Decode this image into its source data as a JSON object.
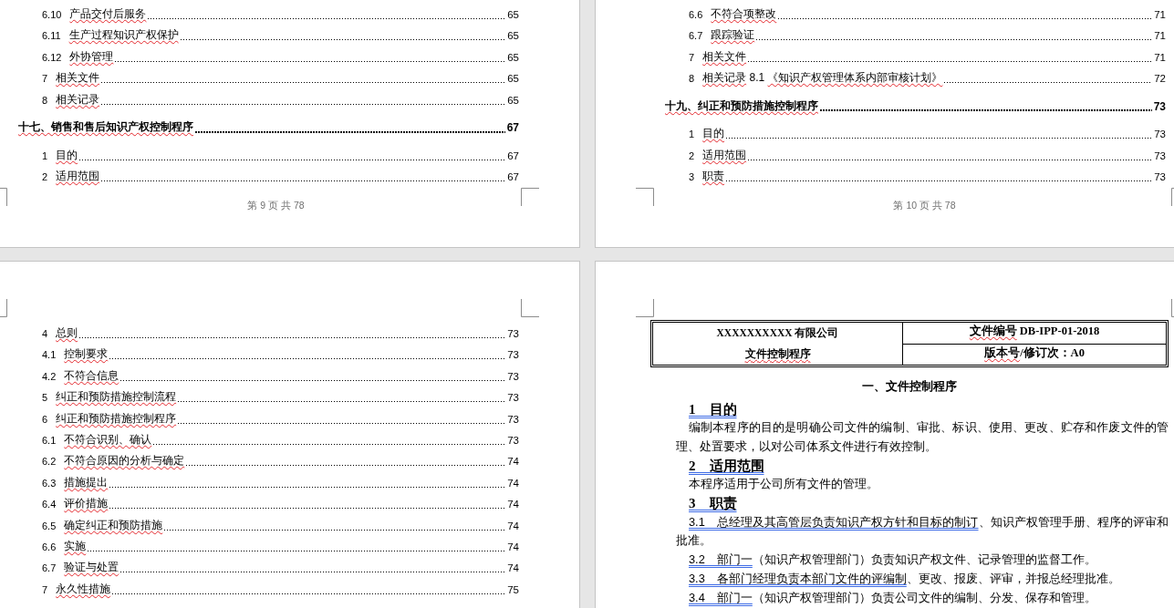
{
  "pages": [
    {
      "kind": "toc",
      "entries": [
        {
          "children": [
            {
              "children": [
                {
                  "number": "6.10",
                  "title": "产品交付后服务",
                  "page": "65",
                  "spelling_error": true
                },
                {
                  "number": "6.11",
                  "title": "生产过程知识产权保护",
                  "page": "65",
                  "spelling_error": true
                },
                {
                  "number": "6.12",
                  "title": "外协管理",
                  "page": "65",
                  "spelling_error": true
                }
              ]
            },
            {
              "number": "7",
              "title": "相关文件",
              "page": "65",
              "spelling_error": true
            },
            {
              "number": "8",
              "title": "相关记录",
              "page": "65",
              "spelling_error": true
            }
          ]
        },
        {
          "title": "十七、销售和售后知识产权控制程序",
          "page": "67",
          "spelling_error": true,
          "children": [
            {
              "number": "1",
              "title": "目的",
              "page": "67",
              "spelling_error": true
            },
            {
              "number": "2",
              "title": "适用范围",
              "page": "67",
              "spelling_error": true
            }
          ]
        }
      ],
      "footer": "第 9 页 共 78"
    },
    {
      "kind": "toc",
      "entries": [
        {
          "children": [
            {
              "children": [
                {
                  "number": "6.6",
                  "title": "不符合项整改",
                  "page": "71",
                  "spelling_error": true
                },
                {
                  "number": "6.7",
                  "title": "跟踪验证",
                  "page": "71",
                  "spelling_error": true
                }
              ]
            },
            {
              "number": "7",
              "title": "相关文件",
              "page": "71",
              "spelling_error": true
            },
            {
              "number": "8",
              "title": [
                {
                  "text": "相关记录",
                  "spelling_error": true
                },
                {
                  "text": " 8.1 "
                },
                {
                  "text": "《知识产权管理体系内部审核计划》",
                  "spelling_error": true
                }
              ],
              "page": "72"
            }
          ]
        },
        {
          "title": "十九、纠正和预防措施控制程序",
          "page": "73",
          "spelling_error": true,
          "children": [
            {
              "number": "1",
              "title": "目的",
              "page": "73",
              "spelling_error": true
            },
            {
              "number": "2",
              "title": "适用范围",
              "page": "73",
              "spelling_error": true
            },
            {
              "number": "3",
              "title": "职责",
              "page": "73",
              "spelling_error": true
            }
          ]
        }
      ],
      "footer": "第 10 页 共 78"
    },
    {
      "kind": "toc",
      "entries": [
        {
          "children": [
            {
              "number": "4",
              "title": "总则",
              "page": "73",
              "spelling_error": true,
              "children": [
                {
                  "number": "4.1",
                  "title": "控制要求",
                  "page": "73",
                  "spelling_error": true
                },
                {
                  "number": "4.2",
                  "title": "不符合信息",
                  "page": "73",
                  "spelling_error": true
                }
              ]
            },
            {
              "number": "5",
              "title": "纠正和预防措施控制流程",
              "page": "73",
              "spelling_error": true
            },
            {
              "number": "6",
              "title": "纠正和预防措施控制程序",
              "page": "73",
              "spelling_error": true,
              "children": [
                {
                  "number": "6.1",
                  "title": "不符合识别、确认",
                  "page": "73",
                  "spelling_error": true
                },
                {
                  "number": "6.2",
                  "title": "不符合原因的分析与确定",
                  "page": "74",
                  "spelling_error": true
                },
                {
                  "number": "6.3",
                  "title": "措施提出",
                  "page": "74",
                  "spelling_error": true
                },
                {
                  "number": "6.4",
                  "title": "评价措施",
                  "page": "74",
                  "spelling_error": true
                },
                {
                  "number": "6.5",
                  "title": "确定纠正和预防措施",
                  "page": "74",
                  "spelling_error": true
                },
                {
                  "number": "6.6",
                  "title": "实施",
                  "page": "74",
                  "spelling_error": true
                },
                {
                  "number": "6.7",
                  "title": "验证与处置",
                  "page": "74",
                  "spelling_error": true
                }
              ]
            },
            {
              "number": "7",
              "title": "永久性措施",
              "page": "75",
              "spelling_error": true
            }
          ]
        }
      ]
    },
    {
      "kind": "document",
      "header_table": {
        "company": "XXXXXXXXXX 有限公司",
        "procedure": [
          {
            "text": "文件控制程序",
            "spelling_error": true
          }
        ],
        "document_number": [
          {
            "text": "文件编号",
            "spelling_error": true
          },
          {
            "text": " DB-IPP-01-2018"
          }
        ],
        "revision": [
          {
            "text": "版本号",
            "spelling_error": true
          },
          {
            "text": "/修订次：A0"
          }
        ]
      },
      "title": "一、文件控制程序",
      "blocks": [
        {
          "kind": "heading",
          "text": "1　目的",
          "grammar_error": true
        },
        {
          "kind": "paragraph",
          "text": "编制本程序的目的是明确公司文件的编制、审批、标识、使用、更改、贮存和作废文件的管理、处置要求，以对公司体系文件进行有效控制。"
        },
        {
          "kind": "heading",
          "text": "2　适用范围",
          "grammar_error": true
        },
        {
          "kind": "paragraph",
          "text": "本程序适用于公司所有文件的管理。"
        },
        {
          "kind": "heading",
          "text": "3　职责",
          "grammar_error": true
        },
        {
          "kind": "paragraph",
          "text": [
            {
              "text": "3.1　总经理及其高管层负责知识产权方针和目标的制订",
              "grammar_error": true
            },
            {
              "text": "、知识产权管理手册、程序的评审和批准。"
            }
          ]
        },
        {
          "kind": "paragraph",
          "text": [
            {
              "text": "3.2　部门一",
              "grammar_error": true
            },
            {
              "text": "（知识产权管理部门）负责知识产权文件、记录管理的监督工作。"
            }
          ]
        },
        {
          "kind": "paragraph",
          "text": [
            {
              "text": "3.3　各部门经理负责本部门文件的评编制",
              "grammar_error": true
            },
            {
              "text": "、更改、报废、评审，并报总经理批准。"
            }
          ]
        },
        {
          "kind": "paragraph",
          "text": [
            {
              "text": "3.4　部门一",
              "grammar_error": true
            },
            {
              "text": "（知识产权管理部门）负责公司文件的编制、分发、保存和管理。"
            }
          ]
        }
      ]
    }
  ]
}
